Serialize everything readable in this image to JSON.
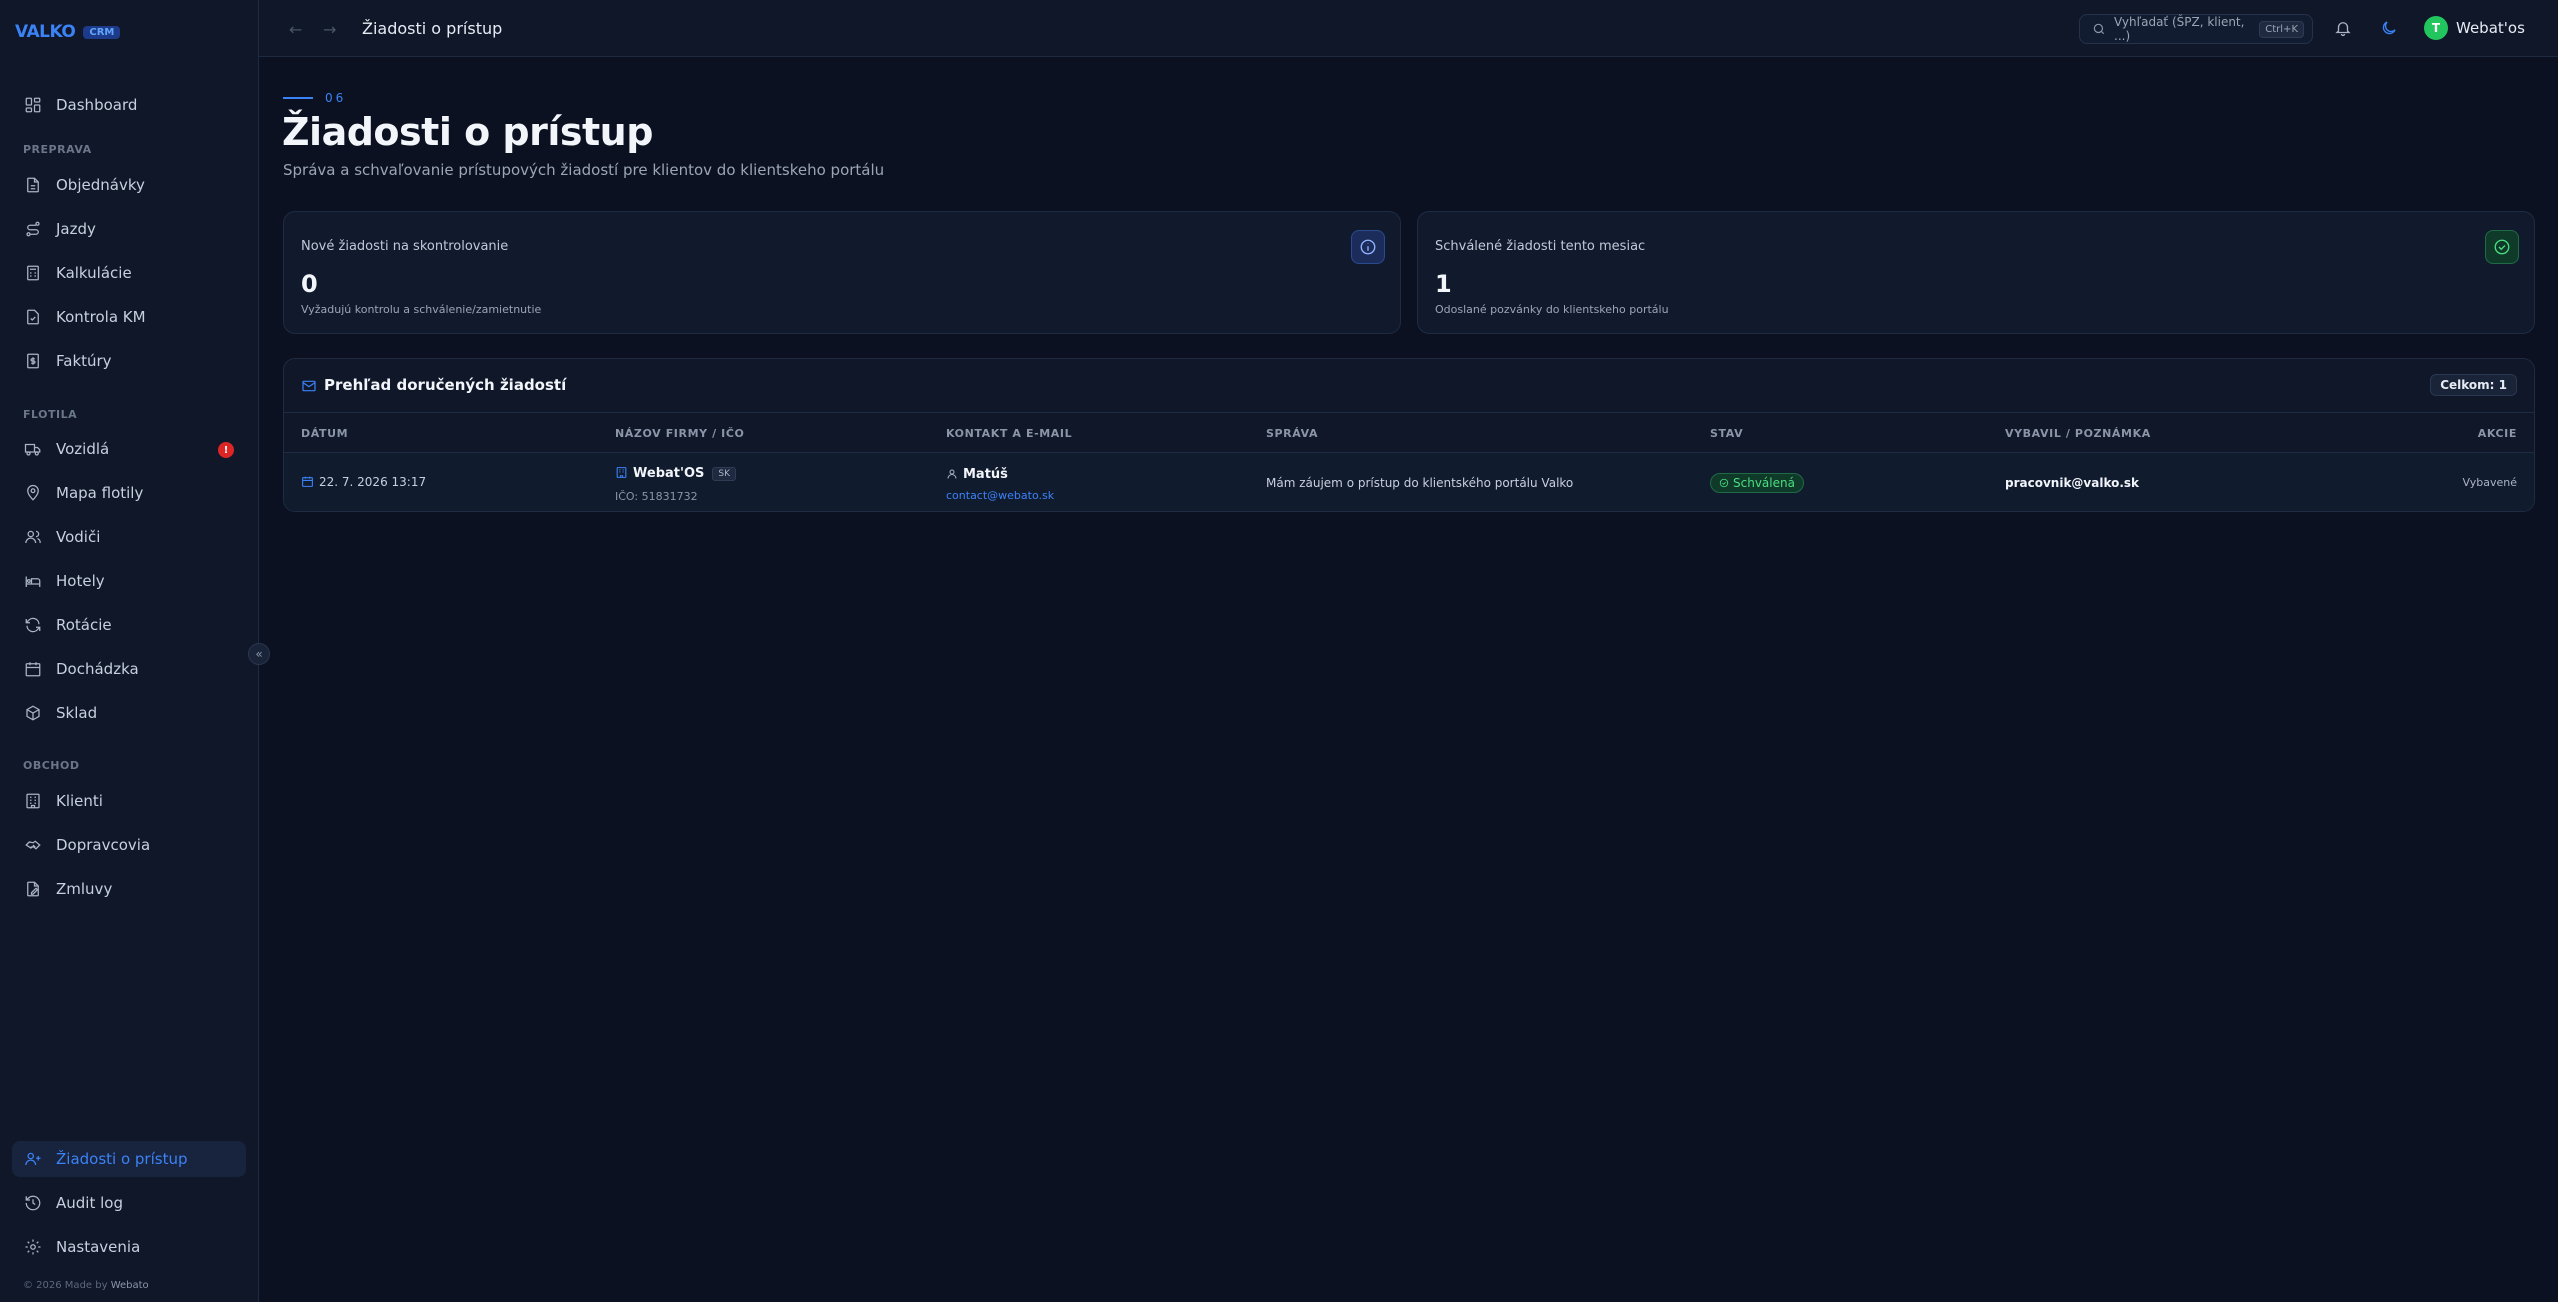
{
  "brand": {
    "name": "VALKO",
    "badge": "CRM"
  },
  "sidebar": {
    "top": [
      {
        "label": "Dashboard",
        "icon": "dashboard-icon"
      }
    ],
    "sections": [
      {
        "title": "PREPRAVA",
        "items": [
          {
            "label": "Objednávky",
            "icon": "file-icon"
          },
          {
            "label": "Jazdy",
            "icon": "route-icon"
          },
          {
            "label": "Kalkulácie",
            "icon": "calculator-icon"
          },
          {
            "label": "Kontrola KM",
            "icon": "document-check-icon"
          },
          {
            "label": "Faktúry",
            "icon": "invoice-icon"
          }
        ]
      },
      {
        "title": "FLOTILA",
        "items": [
          {
            "label": "Vozidlá",
            "icon": "truck-icon",
            "badge": "!"
          },
          {
            "label": "Mapa flotily",
            "icon": "map-pin-icon"
          },
          {
            "label": "Vodiči",
            "icon": "users-icon"
          },
          {
            "label": "Hotely",
            "icon": "bed-icon"
          },
          {
            "label": "Rotácie",
            "icon": "rotate-icon"
          },
          {
            "label": "Dochádzka",
            "icon": "calendar-icon"
          },
          {
            "label": "Sklad",
            "icon": "box-icon"
          }
        ]
      },
      {
        "title": "OBCHOD",
        "items": [
          {
            "label": "Klienti",
            "icon": "building-icon"
          },
          {
            "label": "Dopravcovia",
            "icon": "handshake-icon"
          },
          {
            "label": "Zmluvy",
            "icon": "contract-icon"
          }
        ]
      }
    ],
    "bottom": [
      {
        "label": "Žiadosti o prístup",
        "icon": "user-plus-icon",
        "active": true
      },
      {
        "label": "Audit log",
        "icon": "history-icon"
      },
      {
        "label": "Nastavenia",
        "icon": "gear-icon"
      }
    ],
    "footer_prefix": "© 2026 Made by",
    "footer_brand": "Webato",
    "collapse_glyph": "«"
  },
  "topbar": {
    "title": "Žiadosti o prístup",
    "back_glyph": "←",
    "forward_glyph": "→",
    "search_placeholder": "Vyhľadať (ŠPZ, klient, ...)",
    "search_shortcut": "Ctrl+K",
    "user_initial": "T",
    "user_name": "Webat'os"
  },
  "page": {
    "eyebrow": "06",
    "title": "Žiadosti o prístup",
    "subtitle": "Správa a schvaľovanie prístupových žiadostí pre klientov do klientskeho portálu"
  },
  "cards": [
    {
      "label": "Nové žiadosti na skontrolovanie",
      "value": "0",
      "desc": "Vyžadujú kontrolu a schválenie/zamietnutie",
      "icon": "info-icon",
      "accent": "#3b82f6"
    },
    {
      "label": "Schválené žiadosti tento mesiac",
      "value": "1",
      "desc": "Odoslané pozvánky do klientskeho portálu",
      "icon": "check-circle-icon",
      "accent": "#22c55e"
    }
  ],
  "table": {
    "title": "Prehľad doručených žiadostí",
    "total": "Celkom: 1",
    "headers": [
      "DÁTUM",
      "NÁZOV FIRMY / IČO",
      "KONTAKT A E-MAIL",
      "SPRÁVA",
      "STAV",
      "VYBAVIL / POZNÁMKA",
      "AKCIE"
    ],
    "rows": [
      {
        "date": "22. 7. 2026 13:17",
        "company": "Webat'OS",
        "country": "SK",
        "ico": "IČO: 51831732",
        "contact": "Matúš",
        "email": "contact@webato.sk",
        "message": "Mám záujem o prístup do klientského portálu Valko",
        "status": "Schválená",
        "handled_by": "pracovnik@valko.sk",
        "action": "Vybavené"
      }
    ]
  },
  "colors": {
    "accent": "#3b82f6",
    "success": "#22c55e",
    "danger": "#dc2626",
    "background": "#0b1120"
  }
}
